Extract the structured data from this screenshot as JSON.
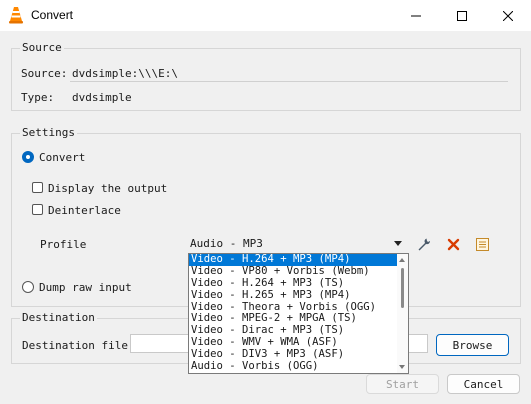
{
  "window": {
    "title": "Convert",
    "icons": [
      "vlc-cone-icon",
      "minimize-icon",
      "maximize-icon",
      "close-icon"
    ]
  },
  "source": {
    "group_title": "Source",
    "source_label": "Source:",
    "source_value": "dvdsimple:\\\\\\E:\\",
    "type_label": "Type:",
    "type_value": "dvdsimple"
  },
  "settings": {
    "group_title": "Settings",
    "convert_label": "Convert",
    "convert_checked": true,
    "display_output_label": "Display the output",
    "display_output_checked": false,
    "deinterlace_label": "Deinterlace",
    "deinterlace_checked": false,
    "profile_label": "Profile",
    "profile_selected": "Audio - MP3",
    "profile_options": [
      "Video - H.264 + MP3 (MP4)",
      "Video - VP80 + Vorbis (Webm)",
      "Video - H.264 + MP3 (TS)",
      "Video - H.265 + MP3 (MP4)",
      "Video - Theora + Vorbis (OGG)",
      "Video - MPEG-2 + MPGA (TS)",
      "Video - Dirac + MP3 (TS)",
      "Video - WMV + WMA (ASF)",
      "Video - DIV3 + MP3 (ASF)",
      "Audio - Vorbis (OGG)"
    ],
    "highlighted_option_index": 0,
    "profile_tool_icons": [
      "wrench-icon",
      "delete-icon",
      "new-profile-icon"
    ],
    "dump_raw_label": "Dump raw input",
    "dump_raw_checked": false
  },
  "destination": {
    "group_title": "Destination",
    "file_label": "Destination file:",
    "file_value": "",
    "browse_label": "Browse"
  },
  "footer": {
    "start_label": "Start",
    "cancel_label": "Cancel"
  },
  "colors": {
    "accent": "#0067c0",
    "selection": "#0078d7",
    "window_bg": "#f0f0f0",
    "delete_red": "#d83b01"
  }
}
